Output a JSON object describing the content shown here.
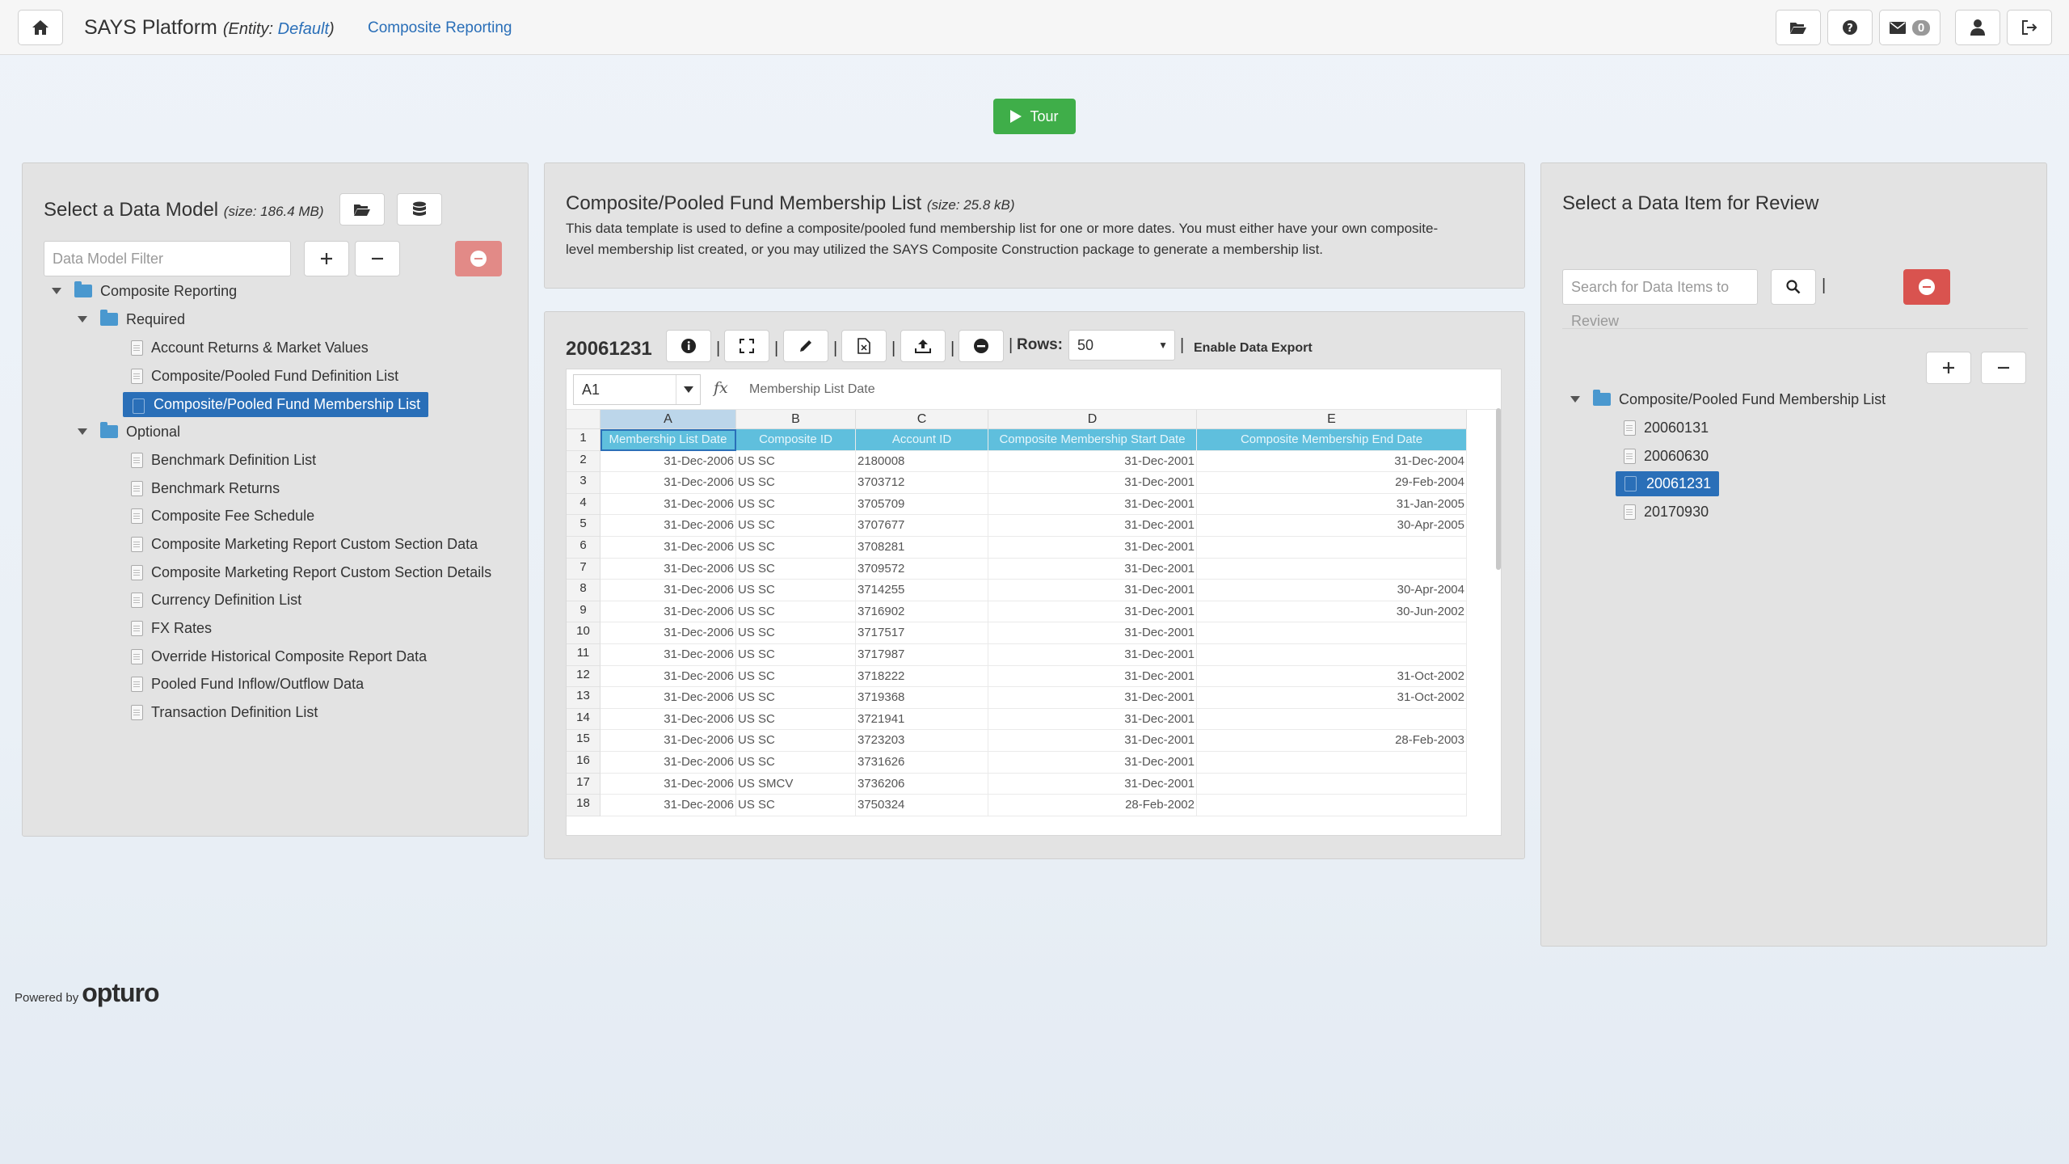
{
  "topbar": {
    "app_name": "SAYS Platform",
    "entity_prefix": "(Entity: ",
    "entity_name": "Default",
    "entity_suffix": ")",
    "breadcrumb": "Composite Reporting",
    "mail_count": "0"
  },
  "tour": {
    "label": "Tour"
  },
  "left": {
    "title": "Select a Data Model",
    "size": "(size: 186.4 MB)",
    "filter_placeholder": "Data Model Filter",
    "tree": {
      "root": "Composite Reporting",
      "required_label": "Required",
      "required_items": [
        "Account Returns & Market Values",
        "Composite/Pooled Fund Definition List",
        "Composite/Pooled Fund Membership List"
      ],
      "optional_label": "Optional",
      "optional_items": [
        "Benchmark Definition List",
        "Benchmark Returns",
        "Composite Fee Schedule",
        "Composite Marketing Report Custom Section Data",
        "Composite Marketing Report Custom Section Details",
        "Currency Definition List",
        "FX Rates",
        "Override Historical Composite Report Data",
        "Pooled Fund Inflow/Outflow Data",
        "Transaction Definition List"
      ]
    }
  },
  "middle": {
    "title": "Composite/Pooled Fund Membership List",
    "size": "(size: 25.8 kB)",
    "desc1": "This data template is used to define a composite/pooled fund membership list for one or more dates. You must either have your own composite-",
    "desc2": "level membership list created, or you may utilized the SAYS Composite Construction package to generate a membership list.",
    "sheet_name": "20061231",
    "rows_label": "Rows:",
    "rows_value": "50",
    "export_label": "Enable Data Export",
    "cell_ref": "A1",
    "formula": "Membership List Date",
    "columns": [
      "A",
      "B",
      "C",
      "D",
      "E"
    ],
    "headers": [
      "Membership List Date",
      "Composite ID",
      "Account ID",
      "Composite Membership Start Date",
      "Composite Membership End Date"
    ],
    "row_numbers": [
      "1",
      "2",
      "3",
      "4",
      "5",
      "6",
      "7",
      "8",
      "9",
      "10",
      "11",
      "12",
      "13",
      "14",
      "15",
      "16",
      "17",
      "18"
    ],
    "rows": [
      [
        "31-Dec-2006",
        "US SC",
        "2180008",
        "31-Dec-2001",
        "31-Dec-2004"
      ],
      [
        "31-Dec-2006",
        "US SC",
        "3703712",
        "31-Dec-2001",
        "29-Feb-2004"
      ],
      [
        "31-Dec-2006",
        "US SC",
        "3705709",
        "31-Dec-2001",
        "31-Jan-2005"
      ],
      [
        "31-Dec-2006",
        "US SC",
        "3707677",
        "31-Dec-2001",
        "30-Apr-2005"
      ],
      [
        "31-Dec-2006",
        "US SC",
        "3708281",
        "31-Dec-2001",
        ""
      ],
      [
        "31-Dec-2006",
        "US SC",
        "3709572",
        "31-Dec-2001",
        ""
      ],
      [
        "31-Dec-2006",
        "US SC",
        "3714255",
        "31-Dec-2001",
        "30-Apr-2004"
      ],
      [
        "31-Dec-2006",
        "US SC",
        "3716902",
        "31-Dec-2001",
        "30-Jun-2002"
      ],
      [
        "31-Dec-2006",
        "US SC",
        "3717517",
        "31-Dec-2001",
        ""
      ],
      [
        "31-Dec-2006",
        "US SC",
        "3717987",
        "31-Dec-2001",
        ""
      ],
      [
        "31-Dec-2006",
        "US SC",
        "3718222",
        "31-Dec-2001",
        "31-Oct-2002"
      ],
      [
        "31-Dec-2006",
        "US SC",
        "3719368",
        "31-Dec-2001",
        "31-Oct-2002"
      ],
      [
        "31-Dec-2006",
        "US SC",
        "3721941",
        "31-Dec-2001",
        ""
      ],
      [
        "31-Dec-2006",
        "US SC",
        "3723203",
        "31-Dec-2001",
        "28-Feb-2003"
      ],
      [
        "31-Dec-2006",
        "US SC",
        "3731626",
        "31-Dec-2001",
        ""
      ],
      [
        "31-Dec-2006",
        "US SMCV",
        "3736206",
        "31-Dec-2001",
        ""
      ],
      [
        "31-Dec-2006",
        "US SC",
        "3750324",
        "28-Feb-2002",
        ""
      ]
    ]
  },
  "right": {
    "title": "Select a Data Item for Review",
    "search_placeholder": "Search for Data Items to Review",
    "tree_root": "Composite/Pooled Fund Membership List",
    "items": [
      "20060131",
      "20060630",
      "20061231",
      "20170930"
    ]
  },
  "footer": {
    "powered_by": "Powered by",
    "logo_text": "opturo"
  }
}
